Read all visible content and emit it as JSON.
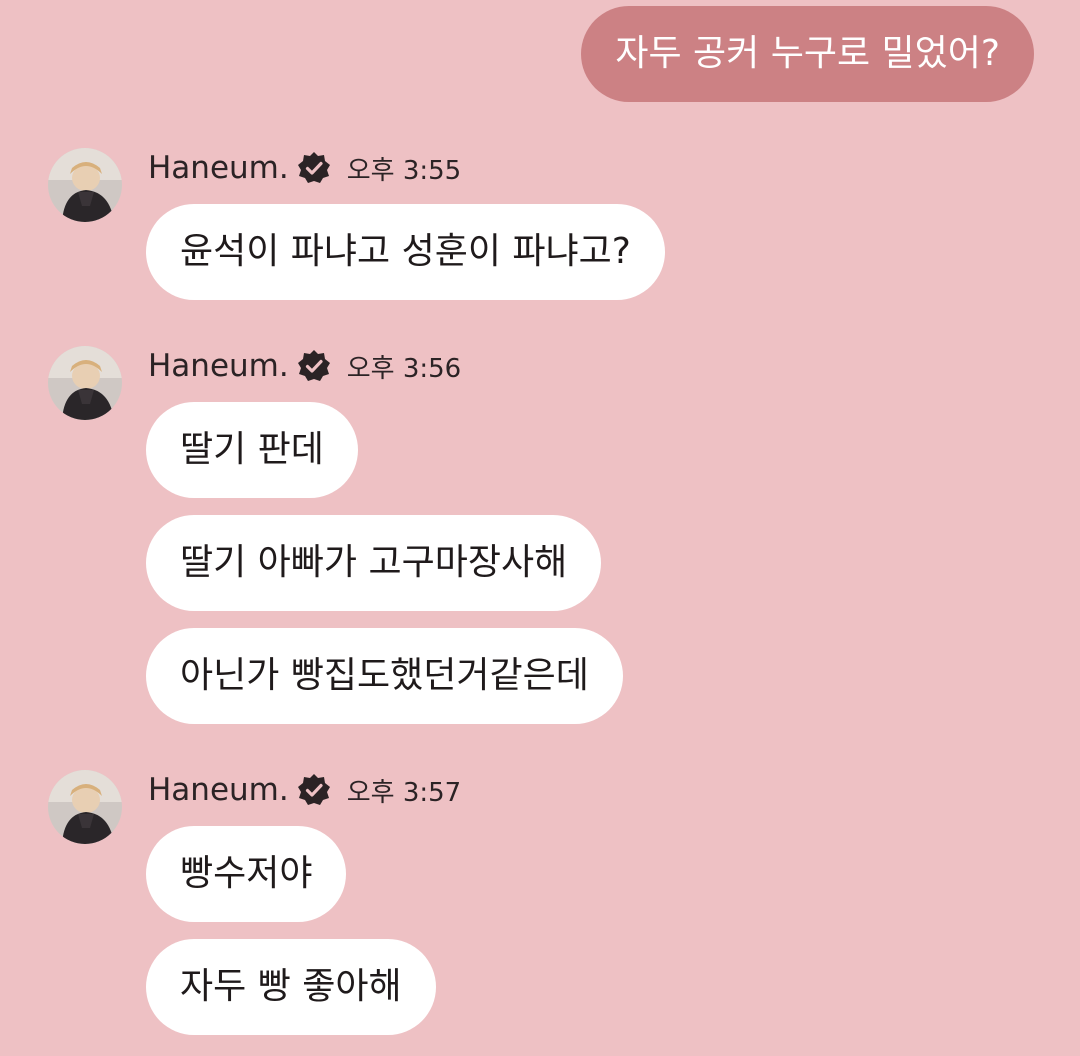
{
  "conversation": {
    "outgoing": {
      "text": "자두 공커 누구로 밀었어?"
    },
    "groups": [
      {
        "sender": "Haneum.",
        "time": "오후 3:55",
        "messages": [
          "윤석이 파냐고 성훈이 파냐고?"
        ]
      },
      {
        "sender": "Haneum.",
        "time": "오후 3:56",
        "messages": [
          "딸기 판데",
          "딸기 아빠가 고구마장사해",
          "아닌가 빵집도했던거같은데"
        ]
      },
      {
        "sender": "Haneum.",
        "time": "오후 3:57",
        "messages": [
          "빵수저야",
          "자두 빵 좋아해"
        ]
      }
    ]
  },
  "colors": {
    "background": "#eec1c4",
    "outgoing_bubble": "#cc8184",
    "incoming_bubble": "#ffffff",
    "text_dark": "#1f1a1b",
    "verified_badge": "#2b2325"
  },
  "icons": {
    "verified": "verified-badge-icon",
    "avatar": "avatar-image"
  }
}
